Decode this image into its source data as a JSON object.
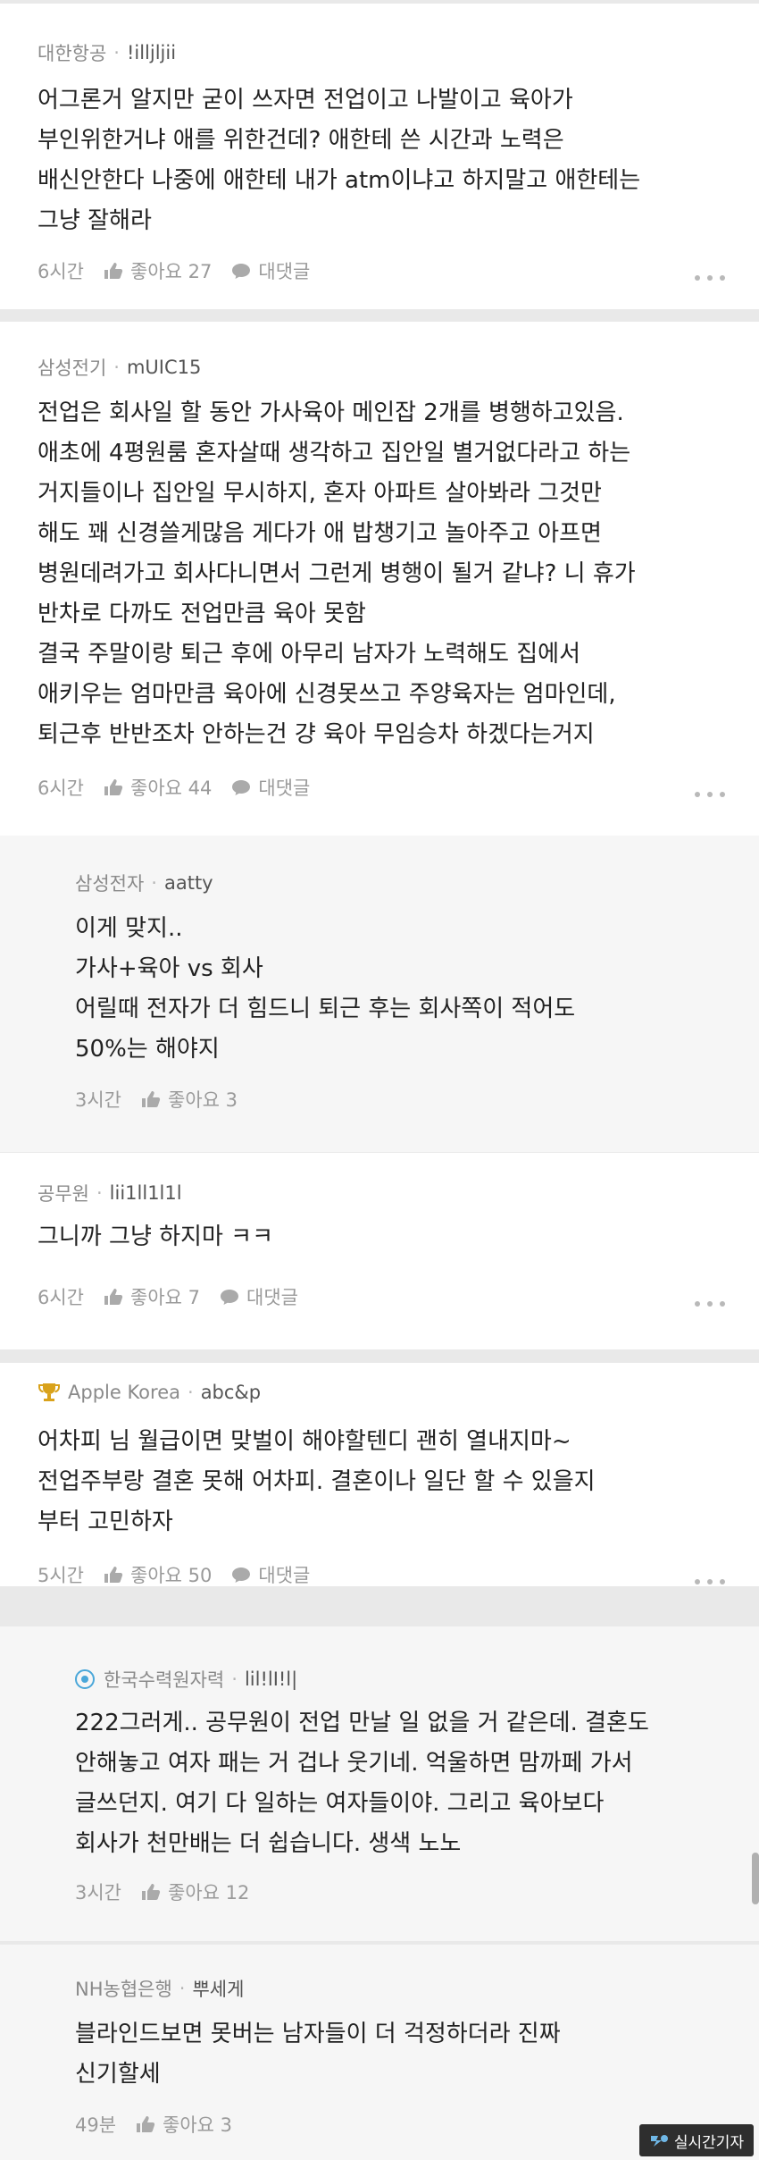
{
  "comments": [
    {
      "company": "대한항공",
      "nickname": "!illjljii",
      "text": "어그론거 알지만 굳이 쓰자면 전업이고 나발이고 육아가\n부인위한거냐 애를 위한건데? 애한테 쓴 시간과 노력은\n배신안한다 나중에 애한테 내가 atm이냐고 하지말고 애한테는\n그냥 잘해라",
      "time": "6시간",
      "likes": "좋아요 27",
      "reply": "대댓글"
    },
    {
      "company": "삼성전기",
      "nickname": "mUIC15",
      "text": "전업은 회사일 할 동안 가사육아 메인잡 2개를 병행하고있음.\n애초에 4평원룸 혼자살때 생각하고 집안일 별거없다라고 하는\n거지들이나 집안일 무시하지, 혼자 아파트 살아봐라 그것만\n해도 꽤 신경쓸게많음 게다가 애 밥챙기고 놀아주고 아프면\n병원데려가고 회사다니면서 그런게 병행이 될거 같냐? 니 휴가\n반차로 다까도 전업만큼 육아 못함\n결국 주말이랑 퇴근 후에 아무리 남자가 노력해도 집에서\n애키우는 엄마만큼 육아에 신경못쓰고 주양육자는 엄마인데,\n퇴근후 반반조차 안하는건 걍 육아 무임승차 하겠다는거지",
      "time": "6시간",
      "likes": "좋아요 44",
      "reply": "대댓글"
    },
    {
      "company": "삼성전자",
      "nickname": "aatty",
      "text": "이게 맞지..\n가사+육아 vs 회사\n어릴때 전자가 더 힘드니 퇴근 후는 회사쪽이 적어도\n50%는 해야지",
      "time": "3시간",
      "likes": "좋아요 3"
    },
    {
      "company": "공무원",
      "nickname": "lii1ll1l1l",
      "text": "그니까 그냥 하지마 ㅋㅋ",
      "time": "6시간",
      "likes": "좋아요 7",
      "reply": "대댓글"
    },
    {
      "company": "Apple Korea",
      "nickname": "abc&p",
      "text": "어차피 님 월급이면 맞벌이 해야할텐디 괜히 열내지마~\n전업주부랑 결혼 못해 어차피. 결혼이나 일단 할 수 있을지\n부터 고민하자",
      "time": "5시간",
      "likes": "좋아요 50",
      "reply": "대댓글"
    },
    {
      "company": "한국수력원자력",
      "nickname": "lil!lI!l|",
      "text": "222그러게.. 공무원이 전업 만날 일 없을 거 같은데. 결혼도\n안해놓고 여자 패는 거 겁나 웃기네. 억울하면 맘까페 가서\n글쓰던지. 여기 다 일하는 여자들이야. 그리고 육아보다\n회사가 천만배는 더 쉽습니다. 생색 노노",
      "time": "3시간",
      "likes": "좋아요 12"
    },
    {
      "company": "NH농협은행",
      "nickname": "뿌세게",
      "text": "블라인드보면 못버는 남자들이 더 걱정하더라 진짜\n신기할세",
      "time": "49분",
      "likes": "좋아요 3"
    }
  ],
  "icons": {
    "like": "thumbs-up-icon",
    "reply": "speech-bubble-icon",
    "more": "more-dots-icon",
    "trophy": "trophy-badge-icon",
    "company_logo": "company-logo-icon"
  },
  "watermark": "실시간기자",
  "colors": {
    "trophy": "#d9a21b",
    "company_logo": "#4aa7d9"
  }
}
